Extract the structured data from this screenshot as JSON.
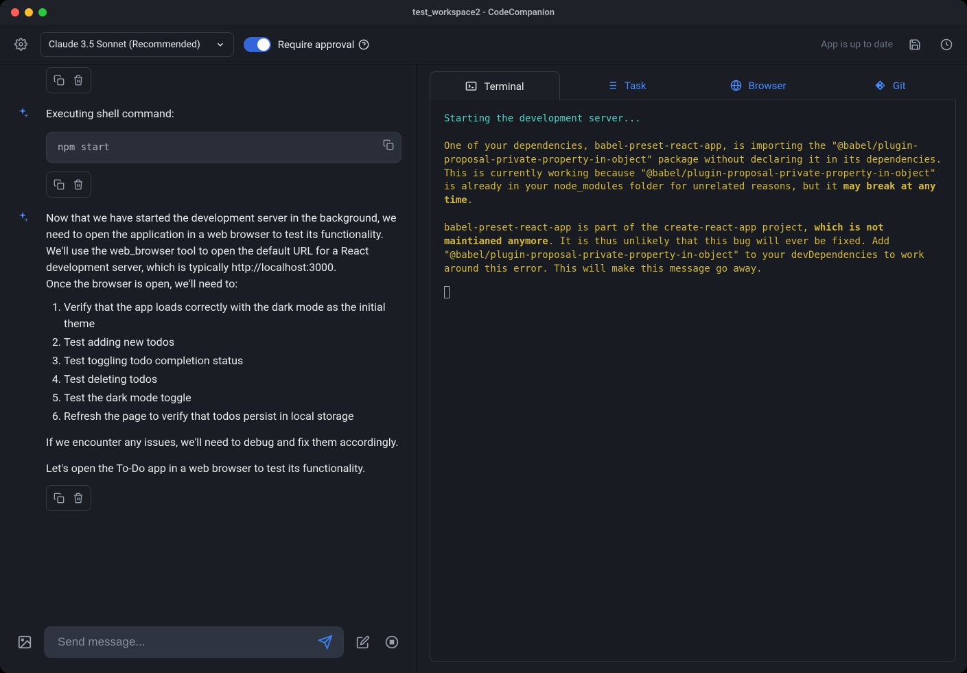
{
  "window": {
    "title": "test_workspace2 - CodeCompanion"
  },
  "toolbar": {
    "model_label": "Claude 3.5 Sonnet (Recommended)",
    "require_approval_label": "Require approval",
    "up_to_date": "App is up to date"
  },
  "chat": {
    "exec_heading": "Executing shell command:",
    "code": "npm start",
    "assistant_p1": "Now that we have started the development server in the background, we need to open the application in a web browser to test its functionality. We'll use the web_browser tool to open the default URL for a React development server, which is typically http://localhost:3000.",
    "assistant_p2": "Once the browser is open, we'll need to:",
    "test_list": [
      "Verify that the app loads correctly with the dark mode as the initial theme",
      "Test adding new todos",
      "Test toggling todo completion status",
      "Test deleting todos",
      "Test the dark mode toggle",
      "Refresh the page to verify that todos persist in local storage"
    ],
    "assistant_p3": "If we encounter any issues, we'll need to debug and fix them accordingly.",
    "assistant_p4": "Let's open the To-Do app in a web browser to test its functionality.",
    "composer_placeholder": "Send message..."
  },
  "tabs": {
    "terminal": "Terminal",
    "task": "Task",
    "browser": "Browser",
    "git": "Git"
  },
  "terminal": {
    "line1": "Starting the development server...",
    "para1_a": "One of your dependencies, babel-preset-react-app, is importing the \"@babel/plugin-proposal-private-property-in-object\" package without declaring it in its dependencies. This is currently working because \"@babel/plugin-proposal-private-property-in-object\" is already in your node_modules folder for unrelated reasons, but it ",
    "para1_b": "may break at any time",
    "para1_c": ".",
    "para2_a": "babel-preset-react-app is part of the create-react-app project, ",
    "para2_b": "which is not maintianed anymore",
    "para2_c": ". It is thus unlikely that this bug will ever be fixed. Add \"@babel/plugin-proposal-private-property-in-object\" to your devDependencies to work around this error. This will make this message go away."
  }
}
